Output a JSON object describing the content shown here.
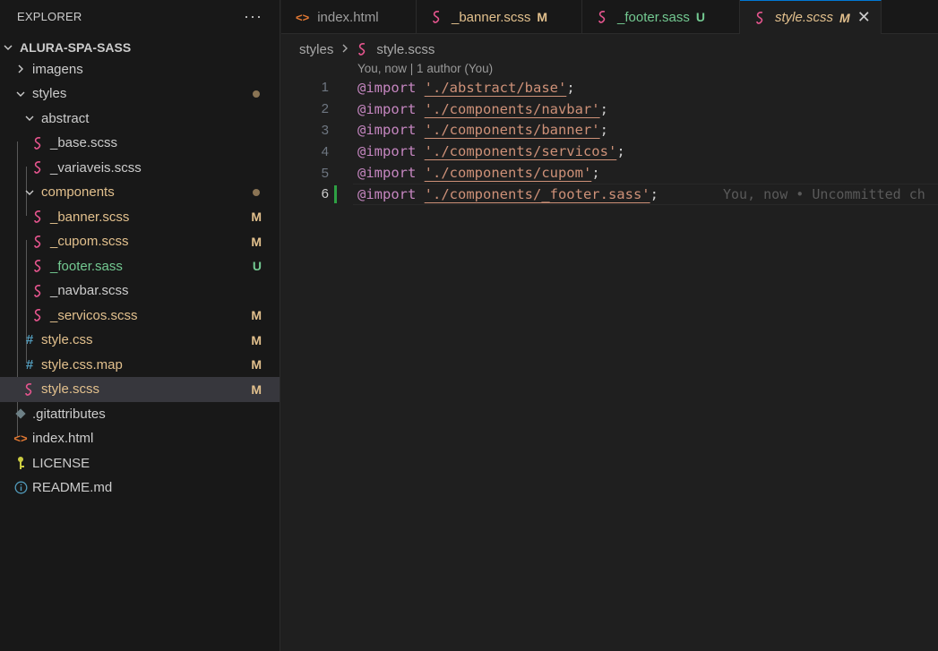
{
  "explorer": {
    "title": "EXPLORER",
    "more": "···",
    "root": "ALURA-SPA-SASS",
    "items": [
      {
        "label": "imagens"
      },
      {
        "label": "styles"
      },
      {
        "label": "abstract"
      },
      {
        "label": "_base.scss"
      },
      {
        "label": "_variaveis.scss"
      },
      {
        "label": "components"
      },
      {
        "label": "_banner.scss",
        "badge": "M"
      },
      {
        "label": "_cupom.scss",
        "badge": "M"
      },
      {
        "label": "_footer.sass",
        "badge": "U"
      },
      {
        "label": "_navbar.scss"
      },
      {
        "label": "_servicos.scss",
        "badge": "M"
      },
      {
        "label": "style.css",
        "badge": "M"
      },
      {
        "label": "style.css.map",
        "badge": "M"
      },
      {
        "label": "style.scss",
        "badge": "M"
      },
      {
        "label": ".gitattributes"
      },
      {
        "label": "index.html"
      },
      {
        "label": "LICENSE"
      },
      {
        "label": "README.md"
      }
    ]
  },
  "tabs": [
    {
      "label": "index.html"
    },
    {
      "label": "_banner.scss",
      "badge": "M"
    },
    {
      "label": "_footer.sass",
      "badge": "U"
    },
    {
      "label": "style.scss",
      "badge": "M",
      "close": "✕"
    }
  ],
  "breadcrumb": {
    "folder": "styles",
    "file": "style.scss"
  },
  "codelens": "You, now | 1 author (You)",
  "editor": {
    "lines": [
      {
        "num": "1",
        "kw": "@import",
        "str": "'./abstract/base'",
        "end": ";"
      },
      {
        "num": "2",
        "kw": "@import",
        "str": "'./components/navbar'",
        "end": ";"
      },
      {
        "num": "3",
        "kw": "@import",
        "str": "'./components/banner'",
        "end": ";"
      },
      {
        "num": "4",
        "kw": "@import",
        "str": "'./components/servicos'",
        "end": ";"
      },
      {
        "num": "5",
        "kw": "@import",
        "str": "'./components/cupom'",
        "end": ";"
      },
      {
        "num": "6",
        "kw": "@import",
        "str": "'./components/_footer.sass'",
        "end": ";"
      }
    ],
    "blame": "You, now • Uncommitted ch"
  },
  "colors": {
    "modified": "#e2c08d",
    "untracked": "#73c991",
    "sass_icon": "#e5558e",
    "html_icon": "#e37933",
    "css_icon": "#519aba"
  }
}
